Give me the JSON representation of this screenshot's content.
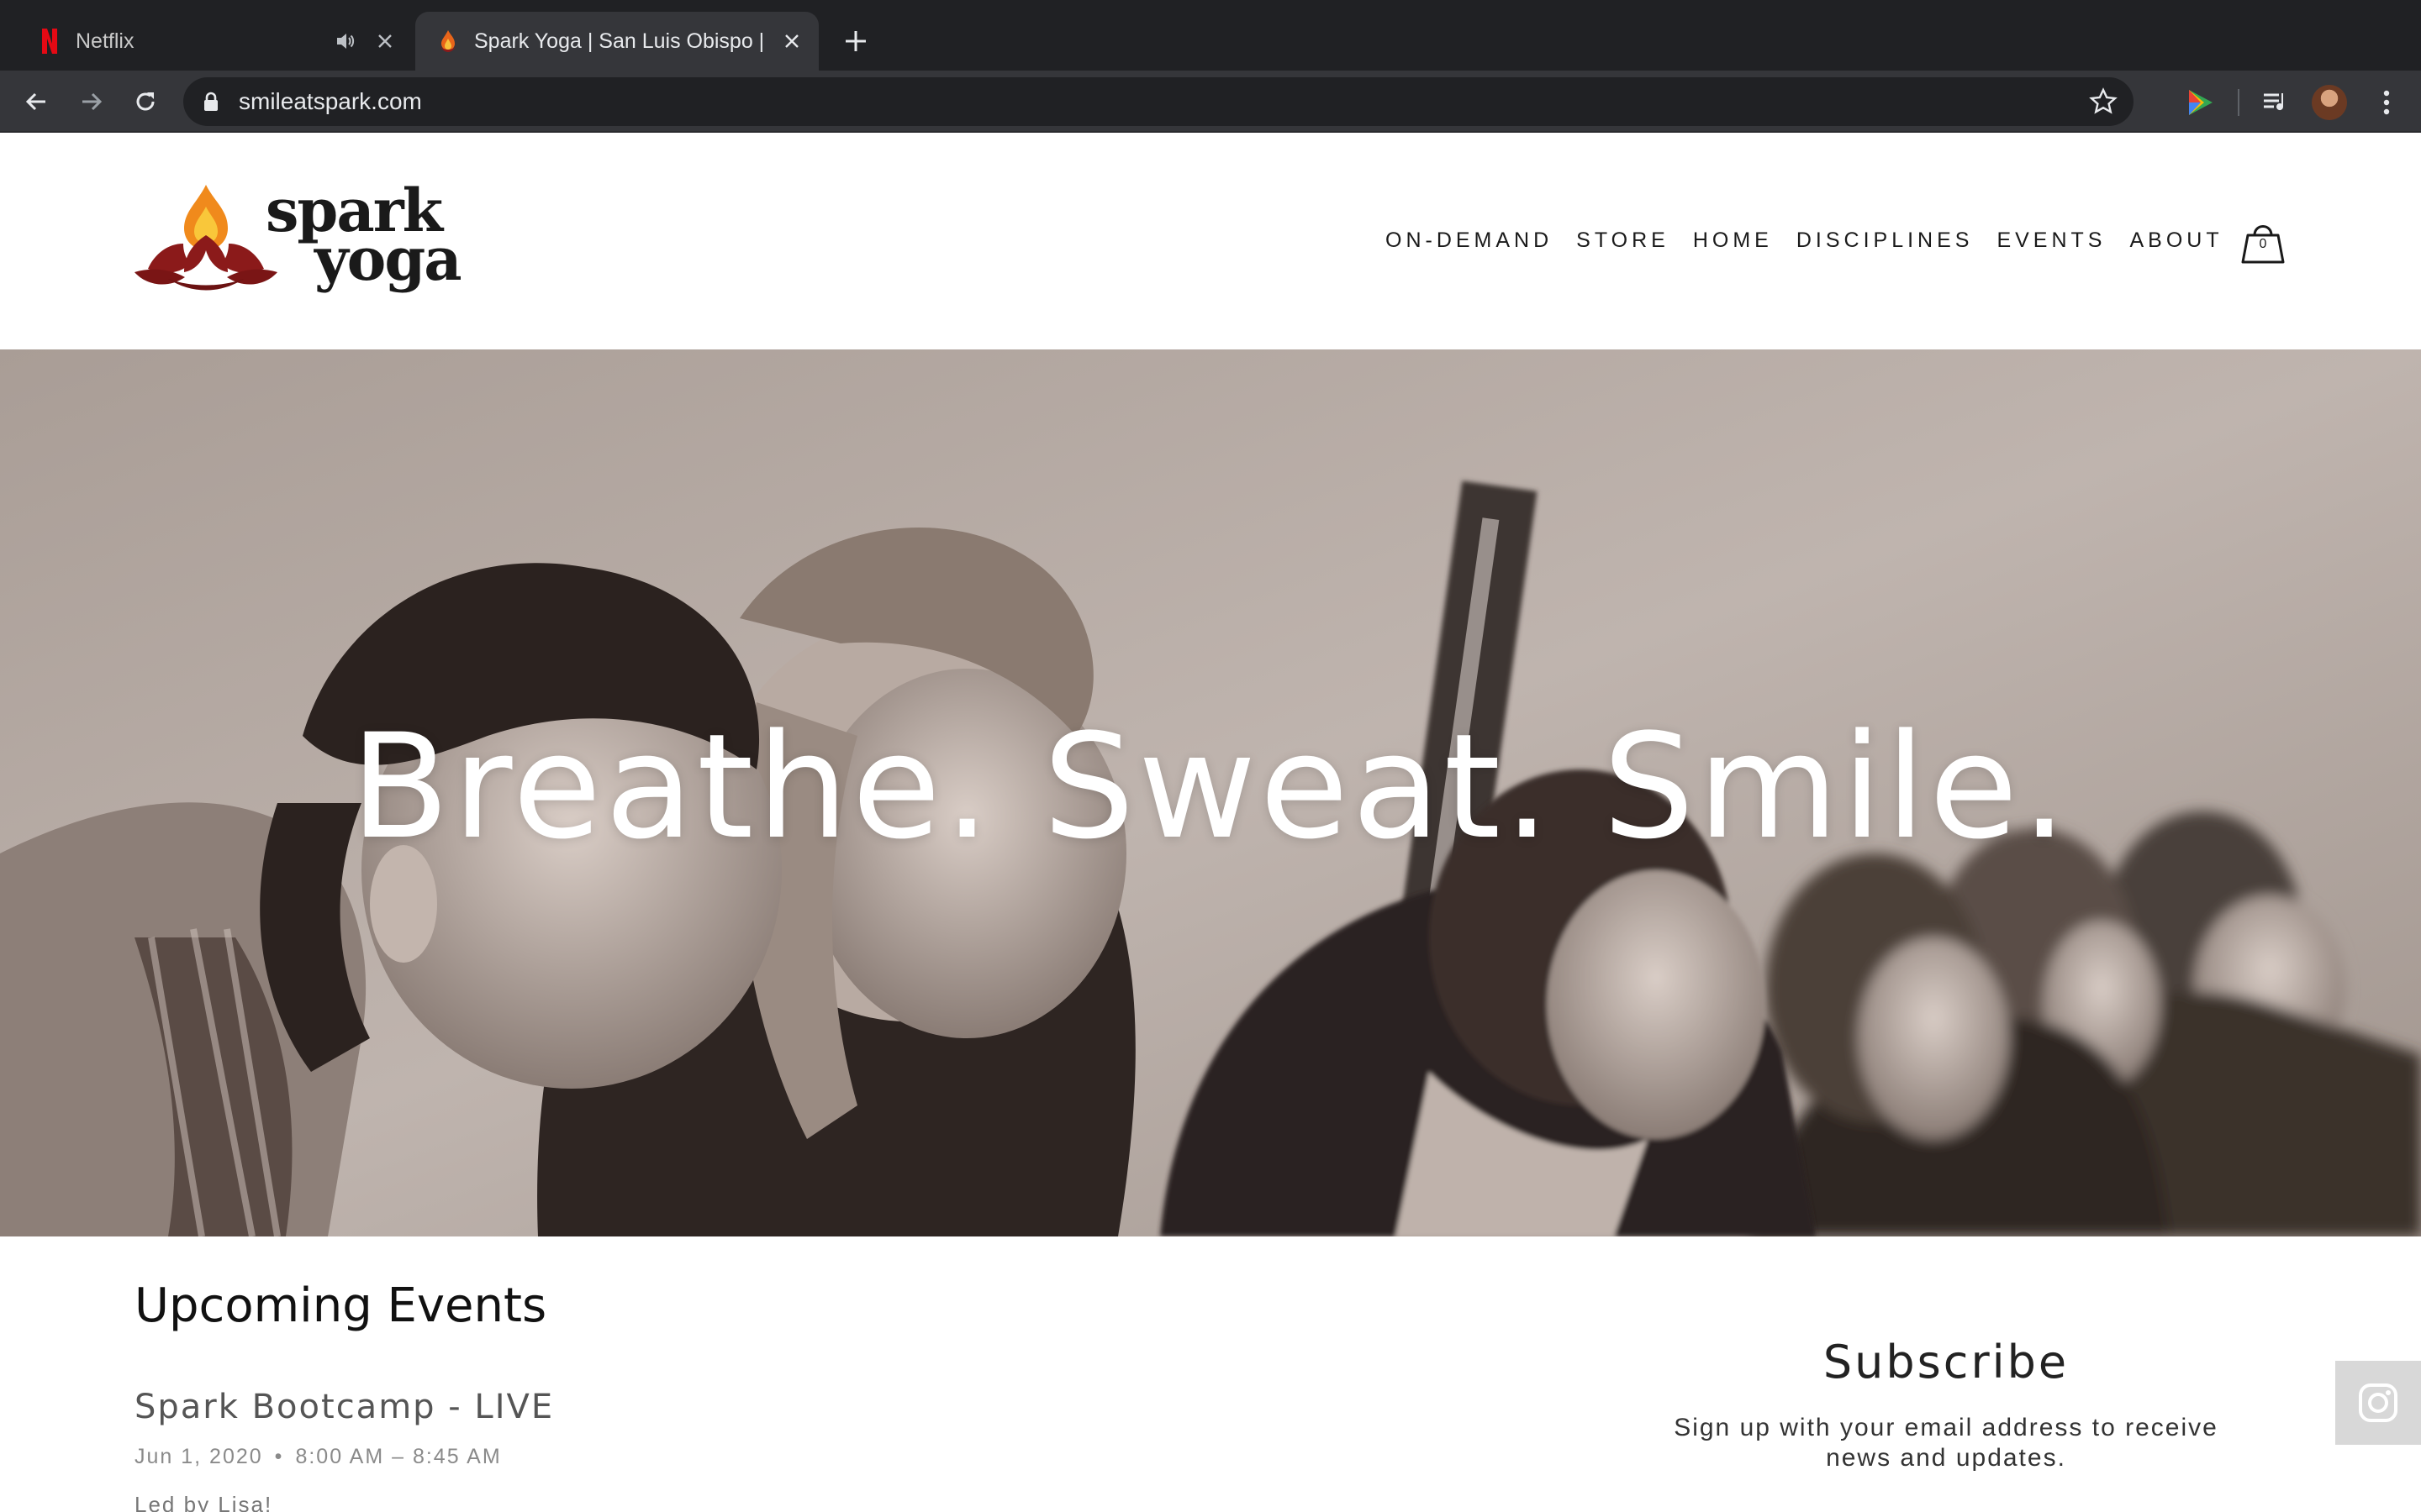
{
  "browser": {
    "tabs": [
      {
        "title": "Netflix",
        "favicon": "netflix-icon",
        "audio": true,
        "active": false
      },
      {
        "title": "Spark Yoga | San Luis Obispo |",
        "favicon": "spark-flame-icon",
        "audio": false,
        "active": true
      }
    ],
    "url": "smileatspark.com"
  },
  "site": {
    "logo": {
      "line1": "spark",
      "line2": "yoga"
    },
    "nav": [
      "ON-DEMAND",
      "STORE",
      "HOME",
      "DISCIPLINES",
      "EVENTS",
      "ABOUT"
    ],
    "cart_count": "0"
  },
  "hero": {
    "title": "Breathe. Sweat. Smile."
  },
  "events": {
    "heading": "Upcoming Events",
    "items": [
      {
        "title": "Spark Bootcamp - LIVE",
        "date": "Jun 1, 2020",
        "time": "8:00 AM – 8:45 AM",
        "lead": "Led by Lisa!"
      }
    ]
  },
  "subscribe": {
    "title": "Subscribe",
    "text": "Sign up with your email address to receive news and updates."
  },
  "colors": {
    "chrome_dark": "#202124",
    "chrome_mid": "#35363a",
    "brand_red": "#8b1a1a",
    "brand_orange": "#f08a1c"
  }
}
